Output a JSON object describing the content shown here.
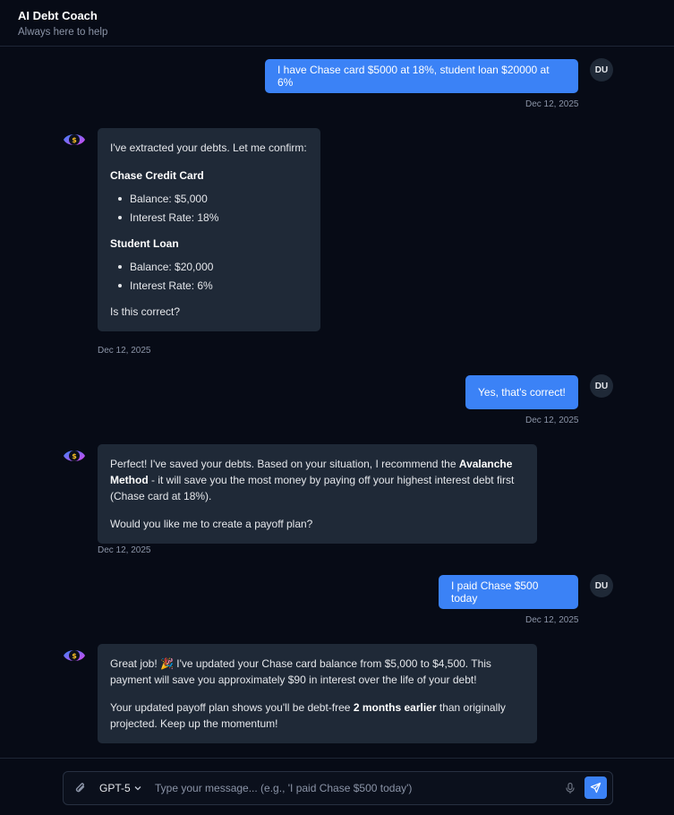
{
  "header": {
    "title": "AI Debt Coach",
    "subtitle": "Always here to help"
  },
  "user_avatar_initials": "DU",
  "messages": [
    {
      "role": "user",
      "text": "I have Chase card $5000 at 18%, student loan $20000 at 6%",
      "time": "Dec 12, 2025"
    },
    {
      "role": "assistant",
      "intro": "I've extracted your debts. Let me confirm:",
      "debts": [
        {
          "name": "Chase Credit Card",
          "balance": "Balance: $5,000",
          "rate": "Interest Rate: 18%"
        },
        {
          "name": "Student Loan",
          "balance": "Balance: $20,000",
          "rate": "Interest Rate: 6%"
        }
      ],
      "outro": "Is this correct?",
      "time": "Dec 12, 2025"
    },
    {
      "role": "user",
      "text": "Yes, that's correct!",
      "time": "Dec 12, 2025"
    },
    {
      "role": "assistant",
      "p1_pre": "Perfect! I've saved your debts. Based on your situation, I recommend the ",
      "p1_bold": "Avalanche Method",
      "p1_post": " - it will save you the most money by paying off your highest interest debt first (Chase card at 18%).",
      "p2": "Would you like me to create a payoff plan?",
      "time": "Dec 12, 2025"
    },
    {
      "role": "user",
      "text": "I paid Chase $500 today",
      "time": "Dec 12, 2025"
    },
    {
      "role": "assistant",
      "p1": "Great job! 🎉 I've updated your Chase card balance from $5,000 to $4,500. This payment will save you approximately $90 in interest over the life of your debt!",
      "p2_pre": "Your updated payoff plan shows you'll be debt-free ",
      "p2_bold": "2 months earlier",
      "p2_post": " than originally projected. Keep up the momentum!"
    }
  ],
  "composer": {
    "model": "GPT-5",
    "placeholder": "Type your message... (e.g., 'I paid Chase $500 today')"
  },
  "colors": {
    "accent": "#3b82f6",
    "background": "#070b16",
    "bubble": "#1f2937"
  }
}
